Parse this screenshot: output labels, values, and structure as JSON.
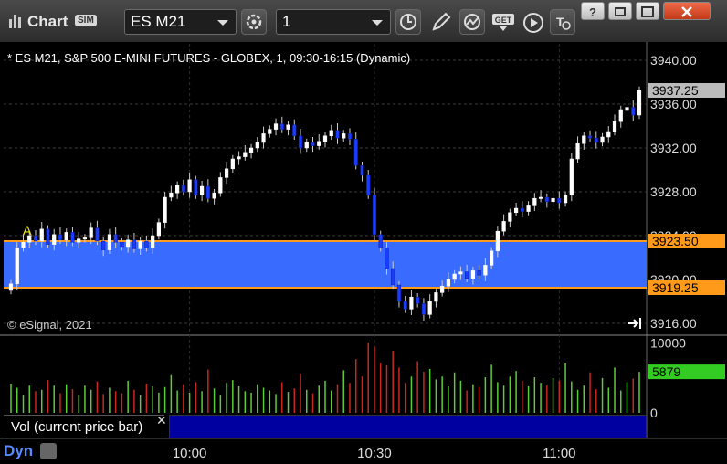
{
  "app": {
    "title": "Chart",
    "mode_badge": "SIM"
  },
  "toolbar": {
    "symbol": "ES M21",
    "interval": "1",
    "buttons": [
      "refresh-icon",
      "clock-icon",
      "pencil-icon",
      "study-icon",
      "get-icon",
      "play-icon",
      "text-icon"
    ]
  },
  "window_buttons": [
    "help-icon",
    "restore-icon",
    "maximize-icon",
    "close-icon"
  ],
  "chart_header": "* ES M21, S&P 500 E-MINI FUTURES - GLOBEX, 1, 09:30-16:15 (Dynamic)",
  "copyright": "© eSignal, 2021",
  "colors": {
    "up": "#ffffff",
    "down": "#1a3cff",
    "band": "#3a6bff",
    "band_line": "#ff9a1a",
    "vol_up": "#5ccc3a",
    "vol_down": "#c8281e",
    "last_price": "#bbbbbb",
    "vol_last": "#33cc22"
  },
  "chart_data": [
    {
      "type": "candlestick",
      "title": "* ES M21, S&P 500 E-MINI FUTURES - GLOBEX, 1, 09:30-16:15 (Dynamic)",
      "y_ticks": [
        "3940.00",
        "3936.00",
        "3932.00",
        "3928.00",
        "3924.00",
        "3920.00",
        "3916.00"
      ],
      "ylim": [
        3915.0,
        3941.5
      ],
      "x_ticks": [
        "10:00",
        "10:30",
        "11:00"
      ],
      "grid": true,
      "marker": {
        "label": "A",
        "price": 3923.7
      },
      "band": {
        "upper": 3923.5,
        "lower": 3919.25
      },
      "labels": {
        "last_price": "3937.25",
        "band_upper": "3923.50",
        "band_lower": "3919.25"
      },
      "closes": [
        3919.6,
        3922.9,
        3923.4,
        3924.0,
        3923.5,
        3924.6,
        3923.2,
        3924.1,
        3923.6,
        3924.3,
        3923.4,
        3923.7,
        3923.8,
        3924.7,
        3923.5,
        3922.7,
        3924.1,
        3923.4,
        3923.0,
        3923.6,
        3922.8,
        3923.5,
        3922.9,
        3924.0,
        3925.2,
        3927.5,
        3927.9,
        3928.6,
        3928.0,
        3929.1,
        3927.7,
        3928.5,
        3927.4,
        3927.9,
        3929.3,
        3930.1,
        3931.0,
        3931.2,
        3931.6,
        3932.0,
        3932.5,
        3933.3,
        3933.7,
        3934.2,
        3933.7,
        3934.1,
        3933.1,
        3932.0,
        3932.5,
        3932.2,
        3932.6,
        3933.1,
        3933.6,
        3932.9,
        3933.3,
        3932.8,
        3930.4,
        3929.5,
        3927.7,
        3924.1,
        3922.9,
        3921.0,
        3919.5,
        3918.0,
        3917.3,
        3918.4,
        3917.8,
        3916.8,
        3918.0,
        3918.8,
        3919.4,
        3920.0,
        3920.5,
        3920.7,
        3920.1,
        3920.8,
        3920.4,
        3921.3,
        3922.6,
        3924.4,
        3925.3,
        3926.1,
        3926.5,
        3926.2,
        3926.8,
        3927.4,
        3927.5,
        3927.1,
        3927.4,
        3927.0,
        3927.7,
        3931.0,
        3932.4,
        3933.1,
        3932.9,
        3932.5,
        3933.0,
        3933.5,
        3934.4,
        3935.5,
        3935.7,
        3935.0,
        3937.25
      ],
      "volume": {
        "ylim": [
          0,
          11000
        ],
        "ticks": [
          "10000",
          "0"
        ],
        "last": "5879",
        "values": [
          4200,
          3600,
          2600,
          3900,
          3100,
          3300,
          4700,
          3900,
          2800,
          4100,
          3400,
          2600,
          3900,
          3300,
          4500,
          2700,
          3600,
          3100,
          2800,
          4600,
          3300,
          2500,
          4200,
          3800,
          2900,
          3700,
          5400,
          3200,
          4100,
          2900,
          4400,
          3100,
          6200,
          3500,
          2600,
          4300,
          4700,
          3800,
          3100,
          2900,
          4100,
          3600,
          3200,
          2700,
          4400,
          3000,
          3500,
          5600,
          3300,
          2800,
          3900,
          4600,
          3200,
          4100,
          6100,
          4300,
          7700,
          5200,
          10100,
          9500,
          7200,
          6800,
          8900,
          6500,
          4300,
          5200,
          7400,
          5900,
          6300,
          4800,
          5200,
          3800,
          5800,
          4600,
          3200,
          4100,
          3700,
          5100,
          6900,
          4400,
          3900,
          5200,
          6000,
          4600,
          3800,
          5100,
          4300,
          3900,
          5000,
          4600,
          7200,
          4500,
          3300,
          3900,
          5800,
          3400,
          5000,
          3600,
          6500,
          3200,
          4400,
          4900,
          5879
        ]
      }
    }
  ],
  "volume_label": "Vol (current price bar)",
  "footer": {
    "mode": "Dyn"
  }
}
